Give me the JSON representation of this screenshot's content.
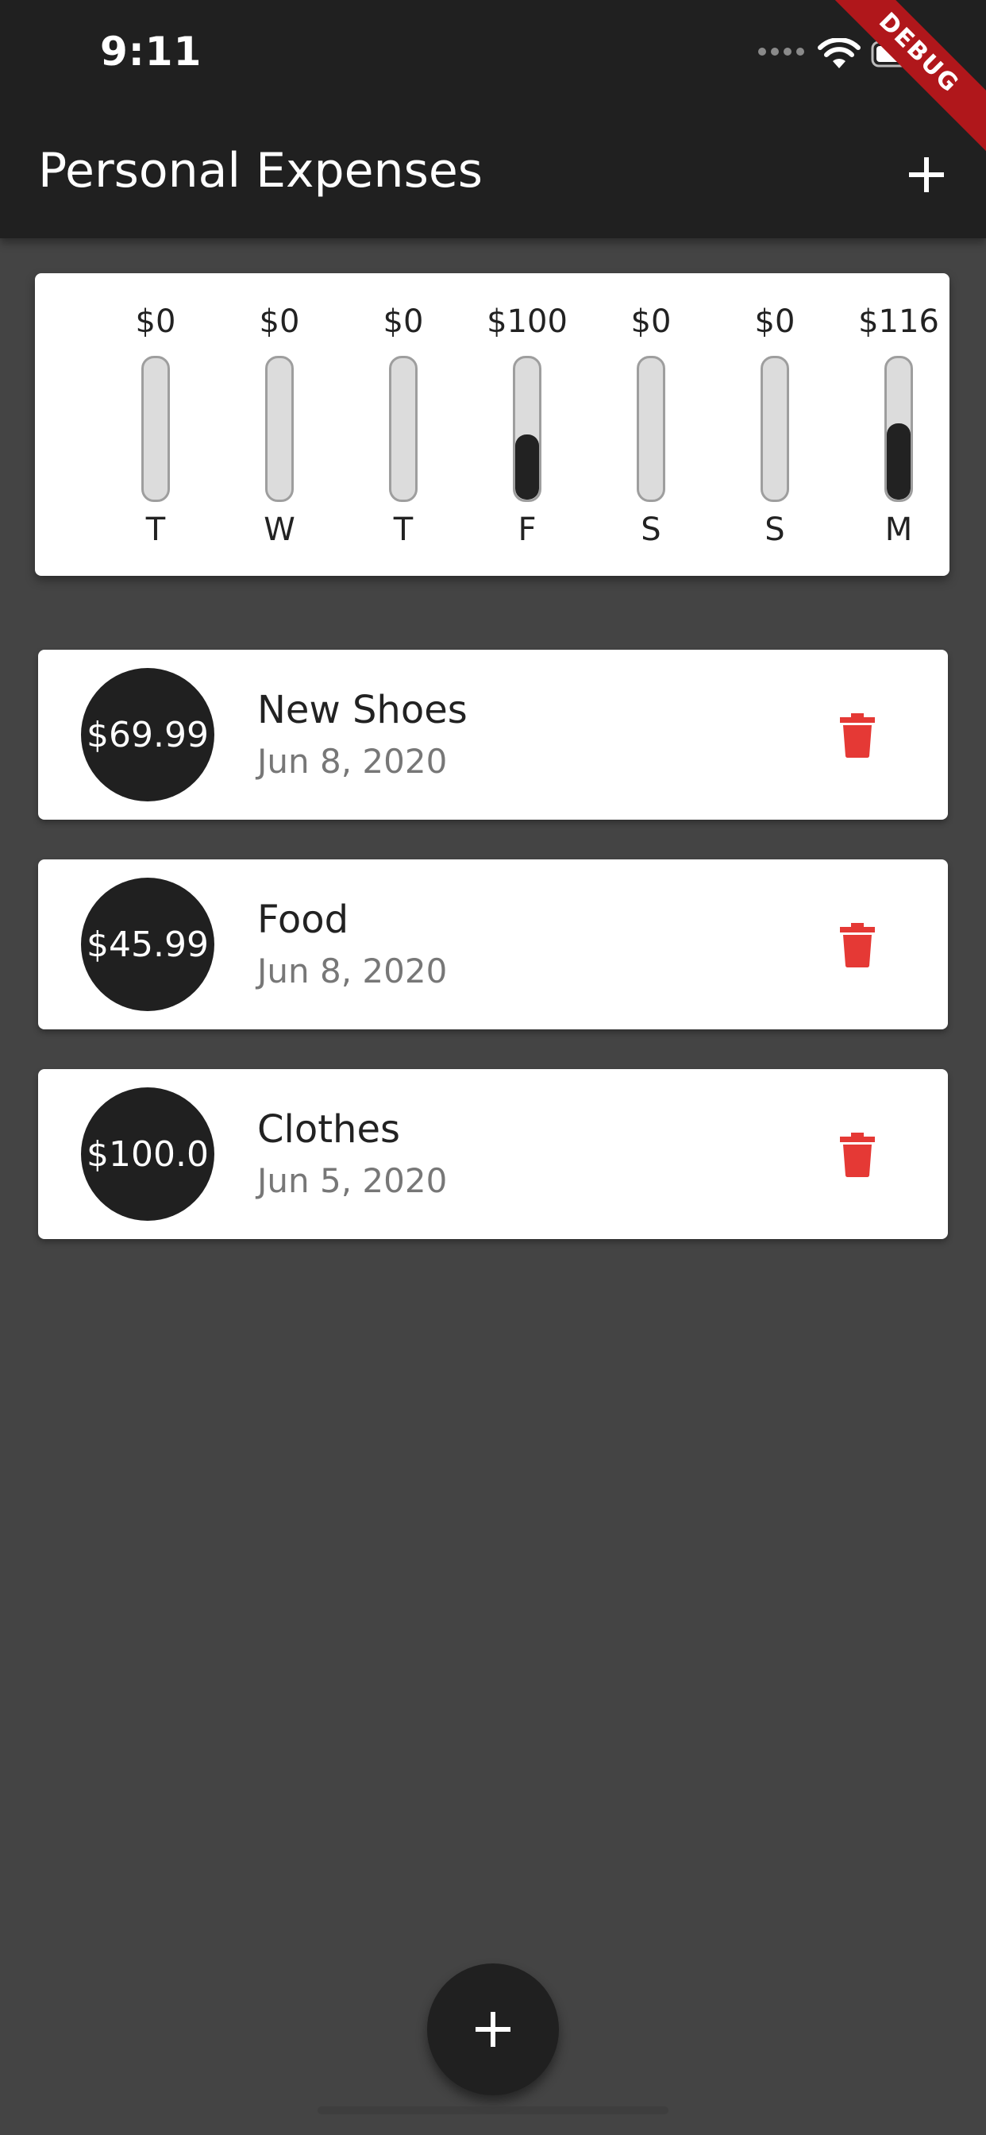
{
  "status_bar": {
    "time": "9:11",
    "debug_label": "DEBUG"
  },
  "app_bar": {
    "title": "Personal Expenses",
    "add_icon": "plus-icon"
  },
  "chart_data": {
    "type": "bar",
    "categories": [
      "T",
      "W",
      "T",
      "F",
      "S",
      "S",
      "M"
    ],
    "value_labels": [
      "$0",
      "$0",
      "$0",
      "$100",
      "$0",
      "$0",
      "$116"
    ],
    "values": [
      0,
      0,
      0,
      100,
      0,
      0,
      116
    ],
    "fill_fraction": [
      0,
      0,
      0,
      0.462,
      0,
      0,
      0.538
    ]
  },
  "transactions": [
    {
      "amount": "$69.99",
      "title": "New Shoes",
      "date": "Jun 8, 2020"
    },
    {
      "amount": "$45.99",
      "title": "Food",
      "date": "Jun 8, 2020"
    },
    {
      "amount": "$100.0",
      "title": "Clothes",
      "date": "Jun 5, 2020"
    }
  ],
  "colors": {
    "primary": "#202020",
    "background": "#444444",
    "delete": "#e53935",
    "card": "#ffffff"
  },
  "fab": {
    "icon": "plus-icon"
  }
}
